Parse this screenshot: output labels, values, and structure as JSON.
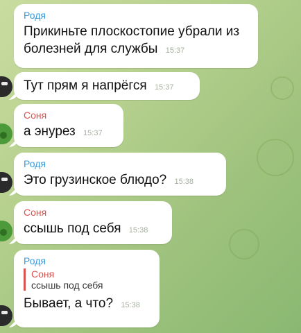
{
  "messages": [
    {
      "sender": "Родя",
      "text": "Прикиньте плоскостопие убрали из болезней для службы",
      "time": "15:37"
    },
    {
      "sender": "",
      "text": "Тут прям я напрёгся",
      "time": "15:37"
    },
    {
      "sender": "Соня",
      "text": "а энурез",
      "time": "15:37"
    },
    {
      "sender": "Родя",
      "text": "Это грузинское блюдо?",
      "time": "15:38"
    },
    {
      "sender": "Соня",
      "text": "ссышь под себя",
      "time": "15:38"
    },
    {
      "sender": "Родя",
      "reply": {
        "sender": "Соня",
        "text": "ссышь под себя"
      },
      "text": "Бывает, а что?",
      "time": "15:38"
    }
  ]
}
